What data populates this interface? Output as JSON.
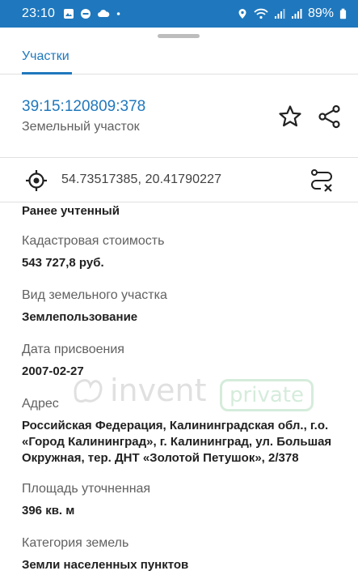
{
  "status_bar": {
    "time": "23:10",
    "battery": "89%",
    "left_icons": [
      "image-icon",
      "minus-circle-icon",
      "cloud-icon",
      "dot-icon"
    ],
    "right_icons": [
      "location-icon",
      "wifi-icon",
      "signal-icon",
      "signal-icon",
      "battery-icon"
    ]
  },
  "tabs": [
    {
      "label": "Участки",
      "active": true
    }
  ],
  "object": {
    "cadastral_number": "39:15:120809:378",
    "type": "Земельный участок"
  },
  "coords": {
    "text": "54.73517385, 20.41790227"
  },
  "fields": [
    {
      "label": "",
      "value": "Ранее учтенный"
    },
    {
      "label": "Кадастровая стоимость",
      "value": "543 727,8 руб."
    },
    {
      "label": "Вид земельного участка",
      "value": "Землепользование"
    },
    {
      "label": "Дата присвоения",
      "value": "2007-02-27"
    },
    {
      "label": "Адрес",
      "value_lines": [
        "Российская Федерация, Калининградская обл., г.о.",
        "«Город Калининград», г. Калининград, ул. Большая",
        "Окружная, тер. ДНТ «Золотой Петушок», 2/378"
      ]
    },
    {
      "label": "Площадь уточненная",
      "value": "396 кв. м"
    },
    {
      "label": "Категория земель",
      "value": "Земли населенных пунктов"
    }
  ],
  "watermark": {
    "brand": "invent",
    "tag": "private"
  },
  "colors": {
    "accent": "#1f78bd",
    "status_bar": "#1f78bd",
    "watermark_green": "#8ac99b"
  }
}
